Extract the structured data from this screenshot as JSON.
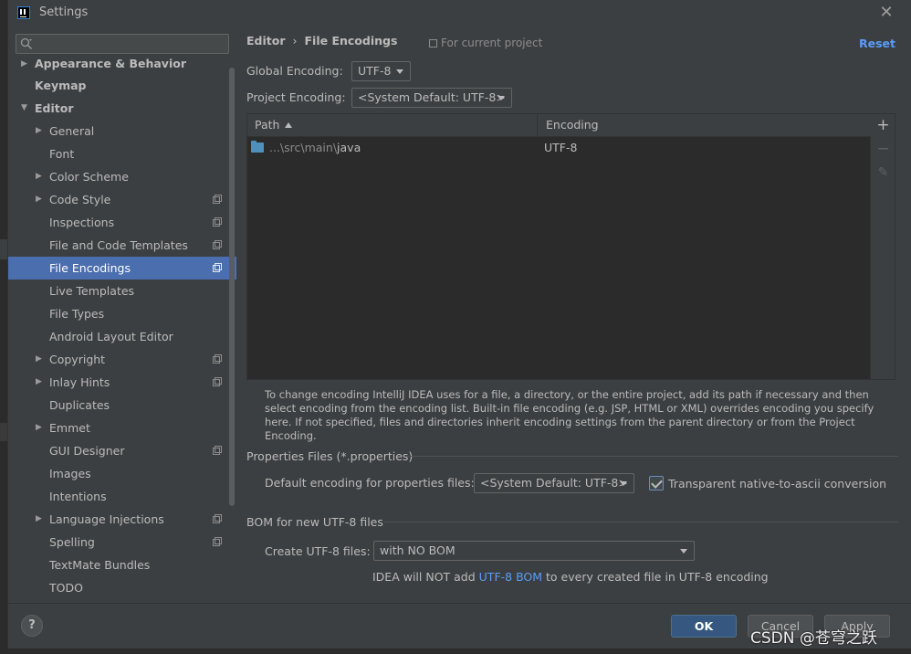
{
  "window": {
    "title": "Settings"
  },
  "sidebar": {
    "search_placeholder": "",
    "items": [
      {
        "label": "Appearance & Behavior",
        "level": 0,
        "expandable": true,
        "expanded": false,
        "bold": true,
        "project": false
      },
      {
        "label": "Keymap",
        "level": 0,
        "expandable": false,
        "bold": true,
        "project": false
      },
      {
        "label": "Editor",
        "level": 0,
        "expandable": true,
        "expanded": true,
        "bold": true,
        "project": false
      },
      {
        "label": "General",
        "level": 1,
        "expandable": true,
        "expanded": false,
        "project": false
      },
      {
        "label": "Font",
        "level": 1,
        "expandable": false,
        "project": false
      },
      {
        "label": "Color Scheme",
        "level": 1,
        "expandable": true,
        "expanded": false,
        "project": false
      },
      {
        "label": "Code Style",
        "level": 1,
        "expandable": true,
        "expanded": false,
        "project": true
      },
      {
        "label": "Inspections",
        "level": 1,
        "expandable": false,
        "project": true
      },
      {
        "label": "File and Code Templates",
        "level": 1,
        "expandable": false,
        "project": true
      },
      {
        "label": "File Encodings",
        "level": 1,
        "expandable": false,
        "project": true,
        "selected": true
      },
      {
        "label": "Live Templates",
        "level": 1,
        "expandable": false,
        "project": false
      },
      {
        "label": "File Types",
        "level": 1,
        "expandable": false,
        "project": false
      },
      {
        "label": "Android Layout Editor",
        "level": 1,
        "expandable": false,
        "project": false
      },
      {
        "label": "Copyright",
        "level": 1,
        "expandable": true,
        "expanded": false,
        "project": true
      },
      {
        "label": "Inlay Hints",
        "level": 1,
        "expandable": true,
        "expanded": false,
        "project": true
      },
      {
        "label": "Duplicates",
        "level": 1,
        "expandable": false,
        "project": false
      },
      {
        "label": "Emmet",
        "level": 1,
        "expandable": true,
        "expanded": false,
        "project": false
      },
      {
        "label": "GUI Designer",
        "level": 1,
        "expandable": false,
        "project": true
      },
      {
        "label": "Images",
        "level": 1,
        "expandable": false,
        "project": false
      },
      {
        "label": "Intentions",
        "level": 1,
        "expandable": false,
        "project": false
      },
      {
        "label": "Language Injections",
        "level": 1,
        "expandable": true,
        "expanded": false,
        "project": true
      },
      {
        "label": "Spelling",
        "level": 1,
        "expandable": false,
        "project": true
      },
      {
        "label": "TextMate Bundles",
        "level": 1,
        "expandable": false,
        "project": false
      },
      {
        "label": "TODO",
        "level": 1,
        "expandable": false,
        "project": false
      }
    ]
  },
  "main": {
    "breadcrumb": {
      "parent": "Editor",
      "separator": "›",
      "current": "File Encodings"
    },
    "for_project": "For current project",
    "reset_label": "Reset",
    "global_encoding": {
      "label": "Global Encoding:",
      "value": "UTF-8"
    },
    "project_encoding": {
      "label": "Project Encoding:",
      "value": "<System Default: UTF-8>"
    },
    "table": {
      "columns": [
        "Path",
        "Encoding"
      ],
      "rows": [
        {
          "path_prefix": "...\\src\\main\\",
          "path_name": "java",
          "encoding": "UTF-8"
        }
      ],
      "tools": {
        "add": "+",
        "remove": "−",
        "edit": "✎"
      }
    },
    "help_text": "To change encoding IntelliJ IDEA uses for a file, a directory, or the entire project, add its path if necessary and then select encoding from the encoding list. Built-in file encoding (e.g. JSP, HTML or XML) overrides encoding you specify here. If not specified, files and directories inherit encoding settings from the parent directory or from the Project Encoding.",
    "properties": {
      "title": "Properties Files (*.properties)",
      "default_label": "Default encoding for properties files:",
      "default_value": "<System Default: UTF-8>",
      "transparent_label": "Transparent native-to-ascii conversion",
      "transparent_checked": true
    },
    "bom": {
      "title": "BOM for new UTF-8 files",
      "create_label": "Create UTF-8 files:",
      "create_value": "with NO BOM",
      "note_prefix": "IDEA will NOT add ",
      "note_link": "UTF-8 BOM",
      "note_suffix": " to every created file in UTF-8 encoding"
    }
  },
  "footer": {
    "help_label": "?",
    "ok_label": "OK",
    "cancel_label": "Cancel",
    "apply_label": "Apply"
  },
  "watermark": "CSDN @苍穹之跃",
  "colors": {
    "background": "#3c3f41",
    "selection": "#4b6eaf",
    "link": "#589df6",
    "ok_button": "#365880",
    "folder": "#4f8fbb"
  }
}
